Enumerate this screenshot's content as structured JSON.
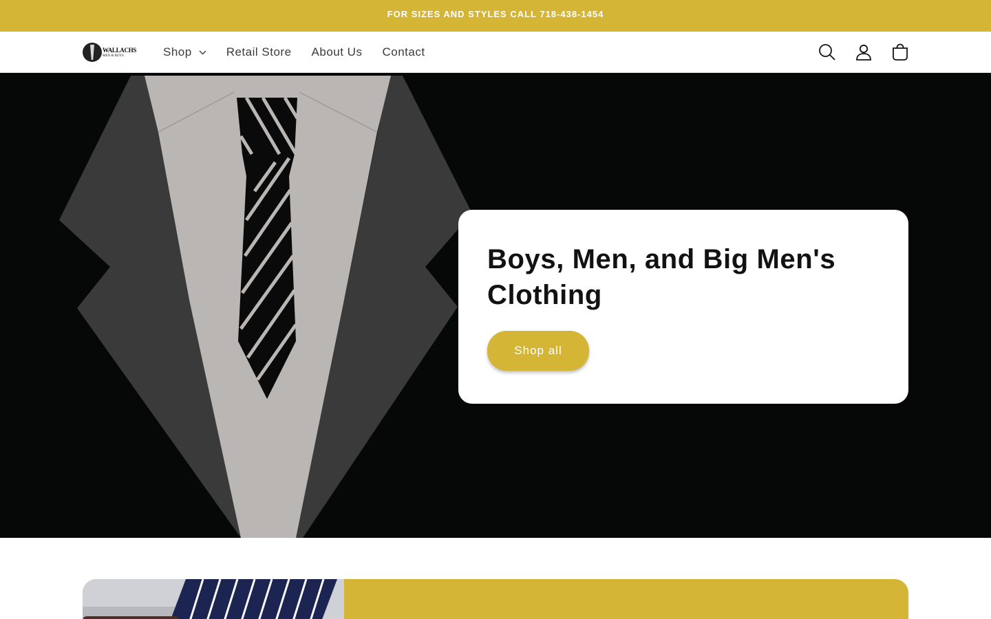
{
  "announcement": {
    "text": "FOR SIZES AND STYLES CALL 718-438-1454"
  },
  "header": {
    "logo": {
      "line1": "WALLACHS",
      "line2": "MEN & BOYS"
    },
    "nav": [
      {
        "label": "Shop",
        "has_dropdown": true
      },
      {
        "label": "Retail Store"
      },
      {
        "label": "About Us"
      },
      {
        "label": "Contact"
      }
    ],
    "icons": [
      "search-icon",
      "account-icon",
      "cart-icon"
    ]
  },
  "hero": {
    "heading": "Boys, Men, and Big Men's Clothing",
    "button_label": "Shop all"
  },
  "colors": {
    "accent": "#d4b535",
    "hero_background": "#060807",
    "jacket": "#3a3a3a",
    "shirt": "#b9b6b3"
  }
}
